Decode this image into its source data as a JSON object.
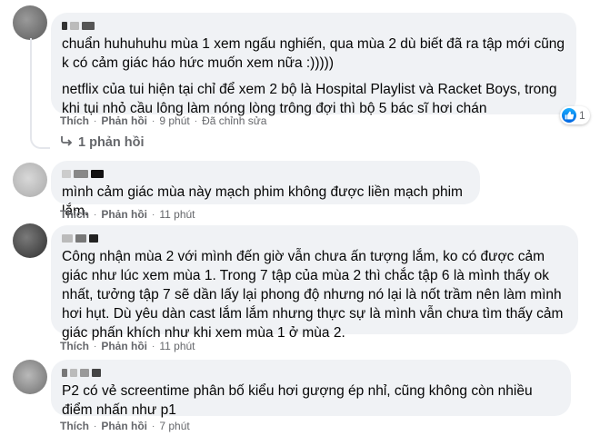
{
  "comments": [
    {
      "paragraphs": [
        "chuẩn huhuhuhu mùa 1 xem ngấu nghiến, qua mùa 2 dù biết đã ra tập mới cũng k có cảm giác háo hức muốn xem nữa :)))))",
        "netflix của tui hiện tại chỉ để xem 2 bộ là Hospital Playlist và Racket Boys, trong khi tụi nhỏ cầu lông làm nóng lòng trông đợi thì bộ 5 bác sĩ hơi chán"
      ],
      "like": "Thích",
      "reply": "Phản hồi",
      "time": "9 phút",
      "edited": "Đã chỉnh sửa",
      "reaction_count": "1",
      "replies_label": "1 phản hồi"
    },
    {
      "paragraphs": [
        "mình cảm giác mùa này mạch phim không được liền mạch phim lắm."
      ],
      "like": "Thích",
      "reply": "Phản hồi",
      "time": "11 phút"
    },
    {
      "paragraphs": [
        "Công nhận mùa 2 với mình đến giờ vẫn chưa ấn tượng lắm, ko có được cảm giác như lúc xem mùa 1. Trong 7 tập của mùa 2 thì chắc tập 6 là mình thấy ok nhất, tưởng tập 7 sẽ dần lấy lại phong độ nhưng nó lại là nốt trầm nên làm mình hơi hụt. Dù yêu dàn cast lắm lắm nhưng thực sự là mình vẫn chưa tìm thấy cảm giác phấn khích như khi xem mùa 1 ở mùa 2."
      ],
      "like": "Thích",
      "reply": "Phản hồi",
      "time": "11 phút"
    },
    {
      "paragraphs": [
        "P2 có vẻ screentime phân bố kiểu hơi gượng ép nhỉ, cũng không còn nhiều điểm nhấn như p1"
      ],
      "like": "Thích",
      "reply": "Phản hồi",
      "time": "7 phút"
    }
  ],
  "colors": {
    "bubble": "#f0f2f5",
    "meta_text": "#65676b",
    "like_blue": "#1877f2"
  },
  "icons": {
    "reaction": "like-icon",
    "replies": "reply-arrow-icon"
  }
}
